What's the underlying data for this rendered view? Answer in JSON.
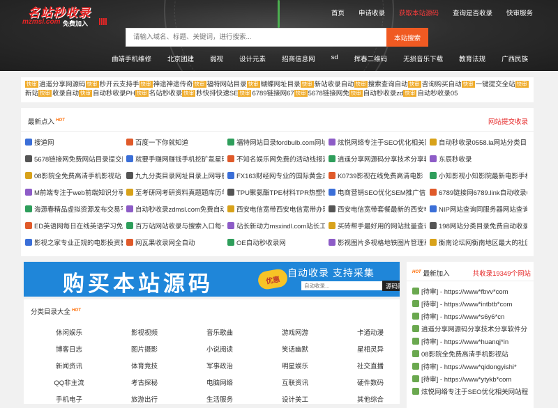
{
  "header": {
    "logo_title": "名站秒收录",
    "logo_domain": "mzmsl.com",
    "logo_free": "免费加入",
    "nav": [
      "首页",
      "申请收录",
      "获取本站源码",
      "查询是否收录",
      "快审服务"
    ],
    "search_placeholder": "请输入域名、标题、关键词，进行搜索...",
    "search_button": "本站搜索",
    "hotwords": [
      "曲靖手机维修",
      "北京团建",
      "弱视",
      "设计元素",
      "招商信息网",
      "sd",
      "挥春二维码",
      "无损音乐下载",
      "教育法规",
      "广西民族"
    ]
  },
  "tags": {
    "badge": "快审",
    "items": [
      "逍遥分享网源码",
      "秒开云支持手",
      "神途神途传奇",
      "福特网站目录",
      "蝴蝶网址目录",
      "新站收录自动",
      "搜索查询自动",
      "咨询购买自动",
      "一键提交全站",
      "新站",
      "收录自动",
      "自动秒收录PH",
      "名站秒收录",
      "秒快排快速SE",
      "6789链接网67",
      "5678链接网免",
      "自动秒收录zd",
      "自动秒收录05"
    ]
  },
  "latest": {
    "title": "最新点入",
    "hot": "HOT",
    "submit_link": "网站提交收录",
    "items": [
      [
        "搜道网",
        "百度一下你就知道",
        "福特网站目录fordbulb.com网址",
        "炫悦网络专注于SEO优化相关网",
        "自动秒收录0558.la网站分类目"
      ],
      [
        "5678链接网免费网站目录提交网",
        "就要手赚网赚钱手机挖矿氪星球",
        "不知名娱乐网免费的活动线报游",
        "逍遥分享网源码分享技术分享软",
        "东辰秒收录"
      ],
      [
        "08影院全免费高清手机影视站",
        "九九分类目录网址目录上网导航",
        "FX163财经网专业的国际黄金走",
        "K0739影视在线免费高清电影",
        "小知影视小知影院最新电影手机"
      ],
      [
        "M前端专注于web前端知识分享码",
        "至考研网考研资料真题题库历年",
        "TPU聚氨酯TPE材料TPR热塑性弹",
        "电商营销SEO优化SEM推广信息流",
        "6789链接网6789.link自动收录6"
      ],
      [
        "海源春精品虚拟资源发布交易平",
        "自动秒收录zdmsl.com免费自动",
        "西安电信宽带西安电信宽带办理",
        "西安电信宽带套餐最新的西安电",
        "NIP网站查询同服务器网站查询"
      ],
      [
        "ED英语网每日在线英语学习免费",
        "百万站网站收录与搜索入口每一",
        "站长新动力msxindl.com站长工",
        "买砖帮手最好用的网站批量查询",
        "198网站分类目录免费自动收录"
      ],
      [
        "影视之家专业正规的电影投资影",
        "网瓦果收录网全自动",
        "OE自动秒收录网",
        "影视图片多视格地铁图片管理系",
        "衡南论坛网衡南地区最大的社区"
      ]
    ]
  },
  "banner": {
    "main": "购买本站源码",
    "sub": "自动收录 支持采集",
    "tag": "优惠",
    "input_placeholder": "自动收录...",
    "button": "源码购买"
  },
  "category": {
    "title": "分类目录大全",
    "rows": [
      [
        "休闲娱乐",
        "影视视频",
        "音乐歌曲",
        "游戏网游",
        "卡通动漫"
      ],
      [
        "博客日志",
        "图片摄影",
        "小说阅读",
        "笑话幽默",
        "星相灵异"
      ],
      [
        "新闻资讯",
        "体育竞技",
        "军事政治",
        "明星娱乐",
        "社交直播"
      ],
      [
        "QQ非主流",
        "考古探秘",
        "电脑网络",
        "互联资讯",
        "硬件数码"
      ],
      [
        "手机电子",
        "旅游出行",
        "生活服务",
        "设计美工",
        "其他综合"
      ]
    ]
  },
  "side": {
    "title": "最新加入",
    "count": "共收录19349个网站",
    "items": [
      "[待审] - https://www*fbvv*com",
      "[待审] - https://www*intbtb*com",
      "[待审] - https://www*s6y6*cn",
      "逍遥分享网源码分享技术分享软件分",
      "[待审] - https://www*huanqj*in",
      "08影院全免费高清手机影视站",
      "[待审] - https://www*qidongyishi*",
      "[待审] - https://www*ytykb*com",
      "炫悦网络专注于SEO优化相关网站程"
    ]
  },
  "colors": {
    "accent": "#f05a22",
    "brand_red": "#e52525",
    "banner_blue": "#1f86d9",
    "tag_badge": "#f0ad2e"
  }
}
